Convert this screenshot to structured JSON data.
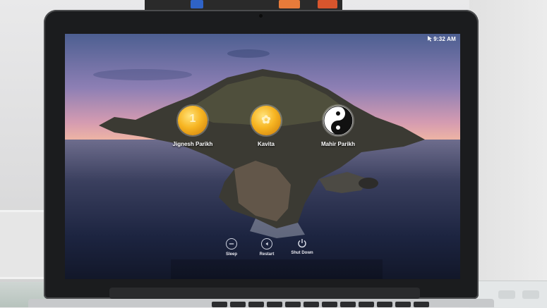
{
  "screen": {
    "menubar": {
      "time": "9:32 AM",
      "icon": "mouse-pointer-icon"
    },
    "users": [
      {
        "name": "Jignesh Parikh",
        "avatar_icon": "gold-coin-icon",
        "glyph": "1"
      },
      {
        "name": "Kavita",
        "avatar_icon": "gold-coin-icon",
        "glyph": "✿"
      },
      {
        "name": "Mahir Parikh",
        "avatar_icon": "yin-yang-icon",
        "glyph": ""
      }
    ],
    "actions": [
      {
        "label": "Sleep",
        "icon": "sleep-icon"
      },
      {
        "label": "Restart",
        "icon": "restart-icon"
      },
      {
        "label": "Shut Down",
        "icon": "power-icon"
      }
    ]
  },
  "colors": {
    "wallpaper_sky": "#8d7fb4",
    "wallpaper_sea": "#1c2440",
    "avatar_gold": "#f7b522",
    "text": "#ffffff"
  }
}
